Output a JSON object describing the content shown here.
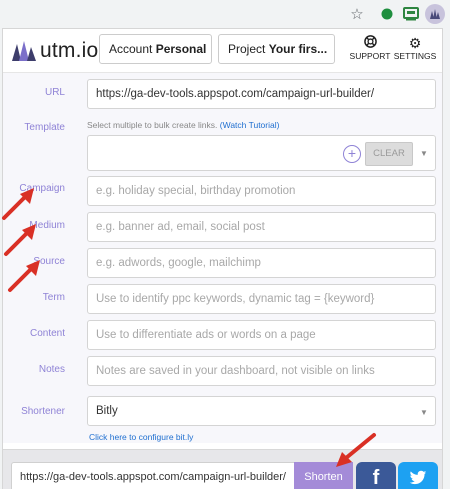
{
  "header": {
    "logo_text": "utm.io",
    "account_label": "Account",
    "account_value": "Personal",
    "project_label": "Project",
    "project_value": "Your firs...",
    "support_label": "SUPPORT",
    "settings_label": "SETTINGS"
  },
  "form": {
    "url": {
      "label": "URL",
      "value": "https://ga-dev-tools.appspot.com/campaign-url-builder/"
    },
    "template": {
      "label": "Template",
      "hint": "Select multiple to bulk create links.",
      "hint_link": "(Watch Tutorial)",
      "clear_label": "CLEAR"
    },
    "campaign": {
      "label": "Campaign",
      "placeholder": "e.g. holiday special, birthday promotion"
    },
    "medium": {
      "label": "Medium",
      "placeholder": "e.g. banner ad, email, social post"
    },
    "source": {
      "label": "Source",
      "placeholder": "e.g. adwords, google, mailchimp"
    },
    "term": {
      "label": "Term",
      "placeholder": "Use to identify ppc keywords, dynamic tag = {keyword}"
    },
    "content": {
      "label": "Content",
      "placeholder": "Use to differentiate ads or words on a page"
    },
    "notes": {
      "label": "Notes",
      "placeholder": "Notes are saved in your dashboard, not visible on links"
    },
    "shortener": {
      "label": "Shortener",
      "value": "Bitly",
      "config_link": "Click here to configure bit.ly"
    }
  },
  "bottom": {
    "short_url": "https://ga-dev-tools.appspot.com/campaign-url-builder/",
    "shorten_label": "Shorten",
    "facebook_glyph": "f",
    "twitter_glyph": "t"
  },
  "colors": {
    "accent": "#8f83d6",
    "shorten_bg": "#a48bd8",
    "facebook": "#3b5998",
    "twitter": "#1da1f2",
    "arrow": "#d93025",
    "link": "#1f6fd0"
  }
}
